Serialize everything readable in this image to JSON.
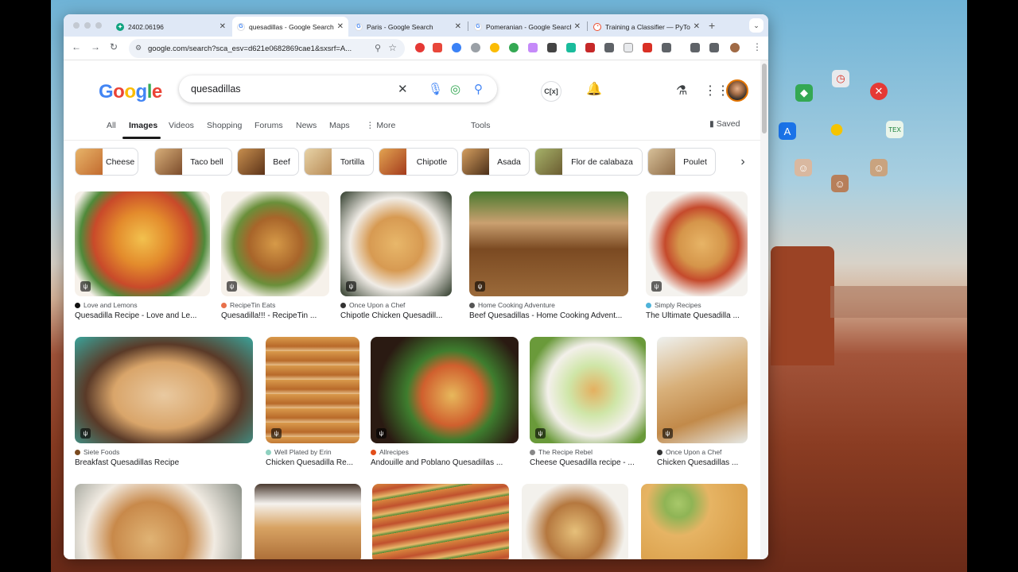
{
  "tabs": [
    {
      "title": "2402.06196",
      "favicon": "chatgpt-icon",
      "color": "#10a37f"
    },
    {
      "title": "quesadillas - Google Search",
      "favicon": "google-icon",
      "color": "#4285f4",
      "active": true
    },
    {
      "title": "Paris - Google Search",
      "favicon": "google-icon",
      "color": "#4285f4"
    },
    {
      "title": "Pomeranian - Google Search",
      "favicon": "google-icon",
      "color": "#4285f4"
    },
    {
      "title": "Training a Classifier — PyTorch",
      "favicon": "pytorch-icon",
      "color": "#ee4c2c"
    }
  ],
  "omnibox": {
    "url": "google.com/search?sca_esv=d621e0682869cae1&sxsrf=A..."
  },
  "search": {
    "query": "quesadillas"
  },
  "header": {
    "cx_label": "C[x]"
  },
  "nav": {
    "tabs": [
      "All",
      "Images",
      "Videos",
      "Shopping",
      "Forums",
      "News",
      "Maps",
      "More"
    ],
    "tools": "Tools",
    "saved": "Saved"
  },
  "chips": [
    "Cheese",
    "Taco bell",
    "Beef",
    "Tortilla",
    "Chipotle",
    "Asada",
    "Flor de calabaza",
    "Poulet"
  ],
  "results_row1": [
    {
      "source": "Love and Lemons",
      "title": "Quesadilla Recipe - Love and Le...",
      "source_color": "#111111"
    },
    {
      "source": "RecipeTin Eats",
      "title": "Quesadilla!!! - RecipeTin ...",
      "source_color": "#e8704a"
    },
    {
      "source": "Once Upon a Chef",
      "title": "Chipotle Chicken Quesadill...",
      "source_color": "#333333"
    },
    {
      "source": "Home Cooking Adventure",
      "title": "Beef Quesadillas - Home Cooking Advent...",
      "source_color": "#555555"
    },
    {
      "source": "Simply Recipes",
      "title": "The Ultimate Quesadilla ...",
      "source_color": "#4fb3d9"
    }
  ],
  "results_row2": [
    {
      "source": "Siete Foods",
      "title": "Breakfast Quesadillas Recipe",
      "source_color": "#7a4a1f"
    },
    {
      "source": "Well Plated by Erin",
      "title": "Chicken Quesadilla Re...",
      "source_color": "#8fd1c0"
    },
    {
      "source": "Allrecipes",
      "title": "Andouille and Poblano Quesadillas ...",
      "source_color": "#e24e1b"
    },
    {
      "source": "The Recipe Rebel",
      "title": "Cheese Quesadilla recipe - ...",
      "source_color": "#888888"
    },
    {
      "source": "Once Upon a Chef",
      "title": "Chicken Quesadillas ...",
      "source_color": "#333333"
    }
  ]
}
